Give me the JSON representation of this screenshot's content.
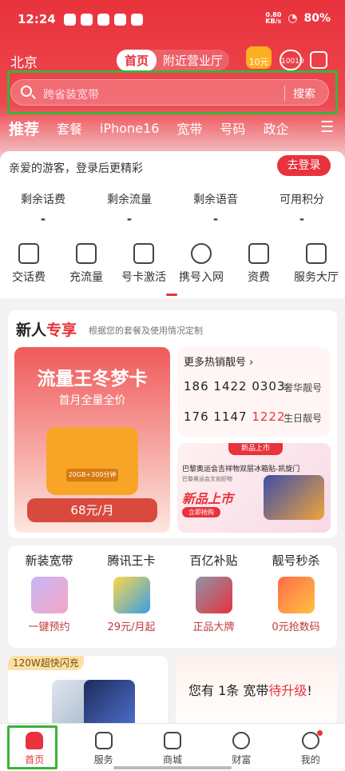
{
  "status_bar": {
    "time": "12:24",
    "net_speed": "0.80",
    "net_unit": "KB/s",
    "battery": "80%"
  },
  "top": {
    "city": "北京",
    "mode_active": "首页",
    "mode_other": "附近营业厅",
    "coin_label": "10元",
    "tel_label": "10010"
  },
  "search": {
    "placeholder": "跨省装宽带",
    "button": "搜索"
  },
  "categories": [
    "推荐",
    "套餐",
    "iPhone16",
    "宽带",
    "号码",
    "政企"
  ],
  "account": {
    "greeting": "亲爱的游客，登录后更精彩",
    "login_button": "去登录",
    "stats": [
      {
        "label": "剩余话费",
        "value": "-"
      },
      {
        "label": "剩余流量",
        "value": "-"
      },
      {
        "label": "剩余语音",
        "value": "-"
      },
      {
        "label": "可用积分",
        "value": "-"
      }
    ]
  },
  "quick_actions": [
    {
      "label": "交话费",
      "icon": "phone-bill-icon"
    },
    {
      "label": "充流量",
      "icon": "folder-data-icon"
    },
    {
      "label": "号卡激活",
      "icon": "sim-activate-icon"
    },
    {
      "label": "携号入网",
      "icon": "globe-icon"
    },
    {
      "label": "资费",
      "icon": "tariff-icon"
    },
    {
      "label": "服务大厅",
      "icon": "grid-icon"
    }
  ],
  "newcomer": {
    "title_a": "新人",
    "title_b": "专享",
    "subtitle": "根据您的套餐及使用情况定制",
    "promo": {
      "title": "流量王冬梦卡",
      "subtitle": "首月全量全价",
      "tag": "20GB+300分钟",
      "price": "68元/月"
    },
    "numbers": {
      "more_label": "更多热销靓号",
      "items": [
        {
          "prefix": "186 1422 0303",
          "hl": "",
          "label": "奢华靓号"
        },
        {
          "prefix": "176 1147 ",
          "hl": "1222",
          "label": "生日靓号"
        }
      ]
    },
    "ad": {
      "ribbon": "新品上市",
      "title": "巴黎奥运会吉祥物双层冰箱贴-凯旋门",
      "subtitle": "巴黎奥运会文创好物",
      "headline": "新品上市",
      "button": "立即抢购"
    }
  },
  "services": [
    {
      "title": "新装宽带",
      "sub": "一键预约"
    },
    {
      "title": "腾讯王卡",
      "sub": "29元/月起"
    },
    {
      "title": "百亿补贴",
      "sub": "正品大牌"
    },
    {
      "title": "靓号秒杀",
      "sub": "0元抢数码"
    }
  ],
  "flash": {
    "tag": "120W超快闪充"
  },
  "upgrade": {
    "a": "您有 1条 宽带",
    "b": "待升级",
    "c": "!"
  },
  "tabs": [
    {
      "label": "首页",
      "icon": "home-icon"
    },
    {
      "label": "服务",
      "icon": "services-icon"
    },
    {
      "label": "商城",
      "icon": "shopping-bag-icon"
    },
    {
      "label": "财富",
      "icon": "wealth-icon"
    },
    {
      "label": "我的",
      "icon": "profile-icon"
    }
  ],
  "colors": {
    "brand": "#e8323c",
    "highlight_frame": "#3bb33b"
  }
}
